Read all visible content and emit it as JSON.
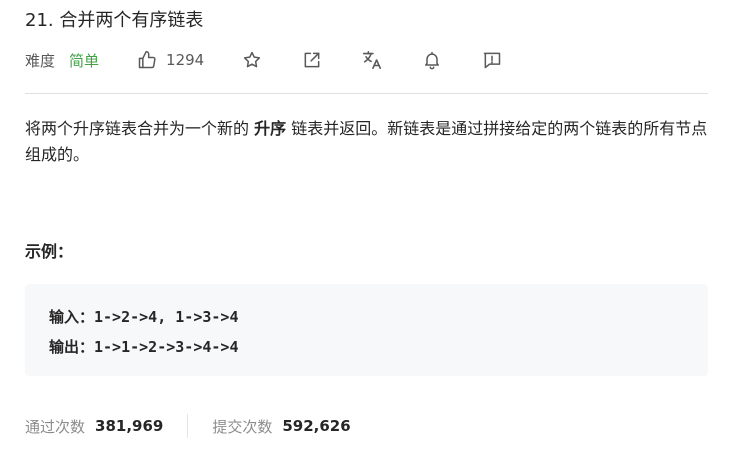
{
  "problem": {
    "title": "21. 合并两个有序链表",
    "difficulty_label": "难度",
    "difficulty": "简单",
    "likes": "1294"
  },
  "icons": {
    "like": "thumbs-up-icon",
    "star": "star-icon",
    "share": "share-icon",
    "translate": "translate-icon",
    "bell": "bell-icon",
    "feedback": "feedback-icon"
  },
  "description": {
    "part1": "将两个升序链表合并为一个新的 ",
    "emphasis": "升序",
    "part2": " 链表并返回。新链表是通过拼接给定的两个链表的所有节点组成的。"
  },
  "example": {
    "title": "示例：",
    "input": "输入：1->2->4, 1->3->4",
    "output": "输出：1->1->2->3->4->4"
  },
  "stats": {
    "accepted_label": "通过次数",
    "accepted_value": "381,969",
    "submissions_label": "提交次数",
    "submissions_value": "592,626"
  },
  "colors": {
    "difficulty_easy": "#43a047",
    "text": "#262626",
    "muted": "#8c8c8c",
    "code_bg": "#f7f8fa"
  }
}
